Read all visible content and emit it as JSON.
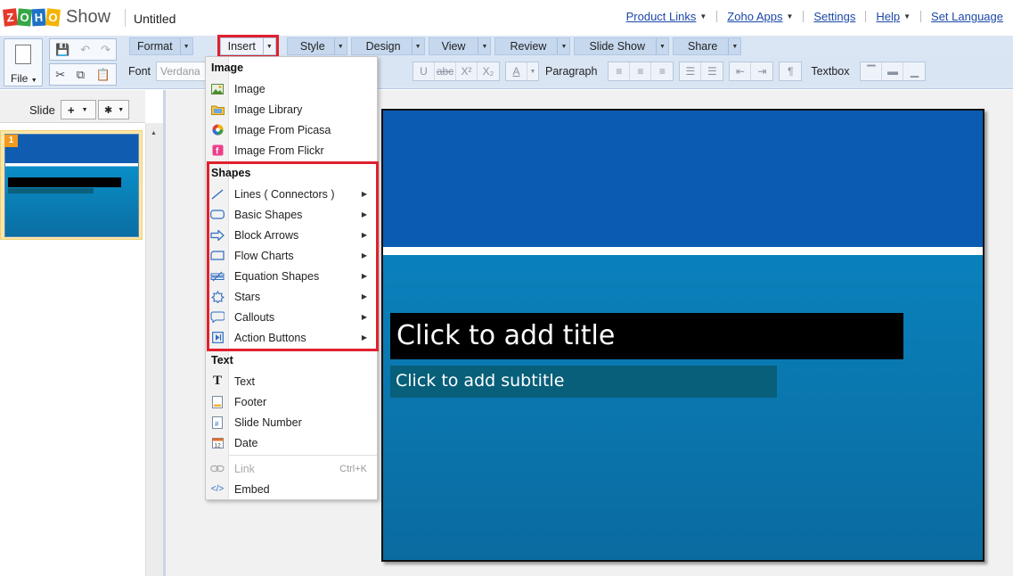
{
  "app": {
    "logo_letters": [
      "Z",
      "O",
      "H",
      "O"
    ],
    "product": "Show",
    "doc_title": "Untitled"
  },
  "top_links": [
    "Product Links",
    "Zoho Apps",
    "Settings",
    "Help",
    "Set Language"
  ],
  "toolbar": {
    "file_label": "File",
    "tabs": [
      "Format",
      "Insert",
      "Style",
      "Design",
      "View",
      "Review",
      "Slide Show",
      "Share"
    ],
    "active_tab": "Insert",
    "font_label": "Font",
    "font_value": "Verdana",
    "paragraph_label": "Paragraph",
    "textbox_label": "Textbox"
  },
  "slide_panel": {
    "label": "Slide",
    "thumb_number": "1"
  },
  "insert_menu": {
    "image_section": "Image",
    "image_items": [
      "Image",
      "Image Library",
      "Image From Picasa",
      "Image From Flickr"
    ],
    "shapes_section": "Shapes",
    "shape_items": [
      "Lines ( Connectors )",
      "Basic Shapes",
      "Block Arrows",
      "Flow Charts",
      "Equation Shapes",
      "Stars",
      "Callouts",
      "Action Buttons"
    ],
    "text_section": "Text",
    "text_items": [
      "Text",
      "Footer",
      "Slide Number",
      "Date"
    ],
    "link_label": "Link",
    "link_shortcut": "Ctrl+K",
    "embed_label": "Embed"
  },
  "slide": {
    "title_placeholder": "Click to add title",
    "subtitle_placeholder": "Click to add subtitle"
  },
  "colors": {
    "highlight": "#e0202d",
    "slide_top": "#0b5bb2",
    "slide_body": "#0a8bc8",
    "link": "#1b48a8"
  }
}
